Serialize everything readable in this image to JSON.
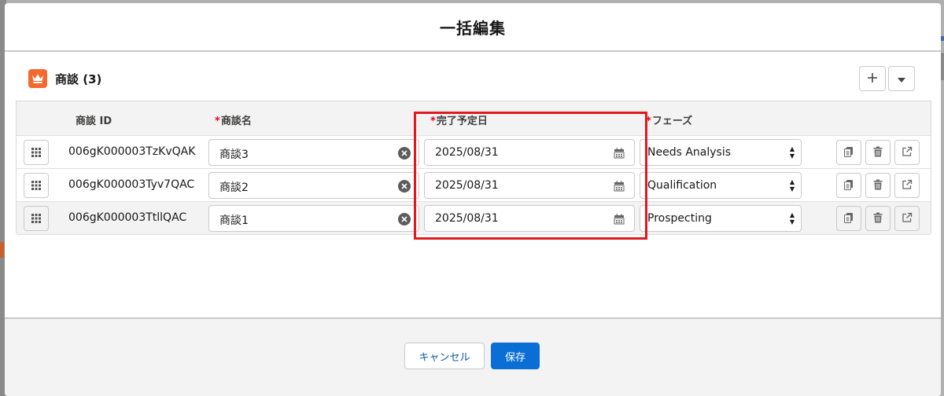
{
  "modal": {
    "title": "一括編集"
  },
  "card": {
    "title": "商談 (3)",
    "icon": "crown-icon"
  },
  "columns": {
    "id": "商談 ID",
    "name": "商談名",
    "close_date": "完了予定日",
    "stage": "フェーズ",
    "required_mark": "*"
  },
  "rows": [
    {
      "id": "006gK000003TzKvQAK",
      "name": "商談3",
      "close_date": "2025/08/31",
      "stage": "Needs Analysis"
    },
    {
      "id": "006gK000003Tyv7QAC",
      "name": "商談2",
      "close_date": "2025/08/31",
      "stage": "Qualification"
    },
    {
      "id": "006gK000003TtllQAC",
      "name": "商談1",
      "close_date": "2025/08/31",
      "stage": "Prospecting"
    }
  ],
  "footer": {
    "cancel_label": "キャンセル",
    "save_label": "保存"
  },
  "colors": {
    "accent": "#0b6ed7",
    "icon_bg": "#f4692e",
    "highlight": "#e0181f",
    "required": "#ea001e"
  }
}
